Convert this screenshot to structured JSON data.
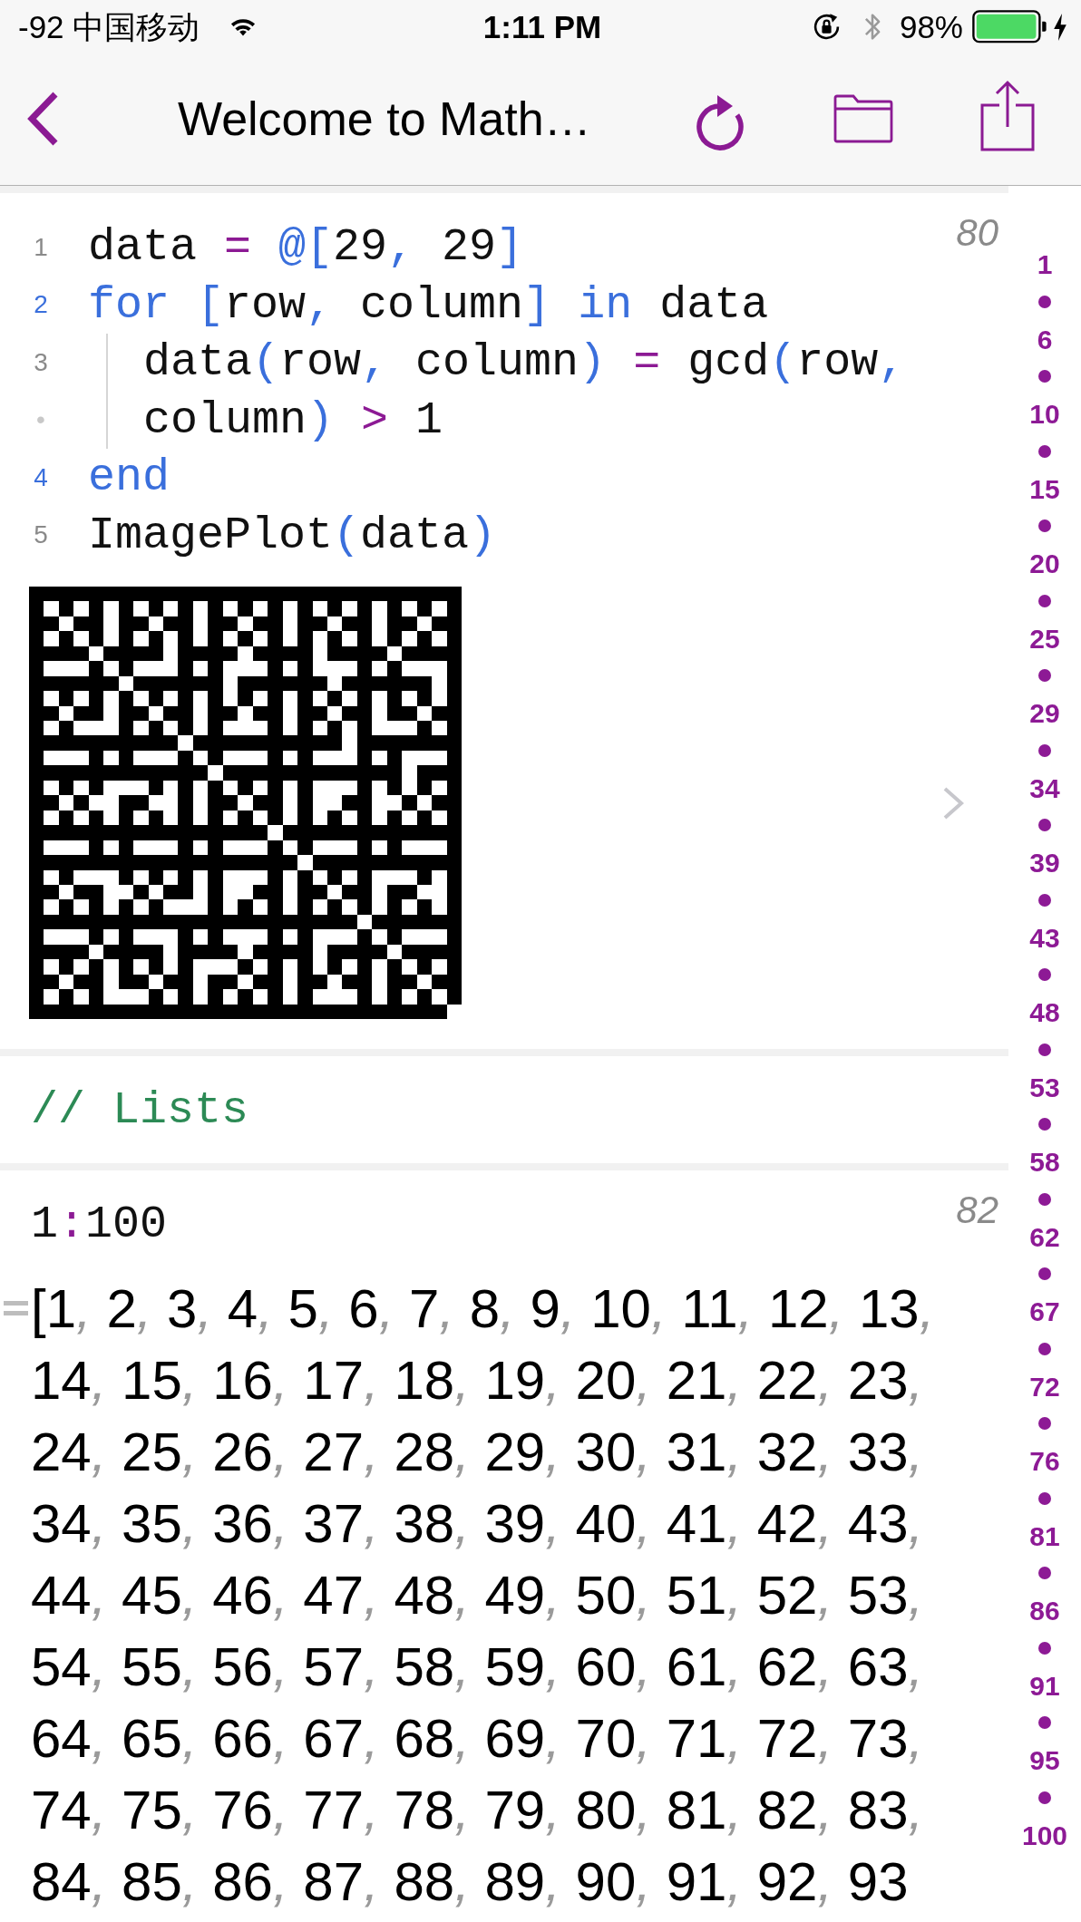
{
  "status_bar": {
    "carrier": "-92 中国移动",
    "time": "1:11 PM",
    "battery": "98%"
  },
  "nav_bar": {
    "title": "Welcome to Math…"
  },
  "cells": [
    {
      "counter": "80",
      "lines": [
        {
          "number": "1",
          "color": "#8a8a8a",
          "tokens": [
            {
              "text": "data ",
              "kind": "ident"
            },
            {
              "text": "=",
              "kind": "operator"
            },
            {
              "text": " @[",
              "kind": "punct"
            },
            {
              "text": "29",
              "kind": "number"
            },
            {
              "text": ", ",
              "kind": "punct"
            },
            {
              "text": "29",
              "kind": "number"
            },
            {
              "text": "]",
              "kind": "punct"
            }
          ]
        },
        {
          "number": "2",
          "color": "#3a6fdc",
          "tokens": [
            {
              "text": "for ",
              "kind": "keyword"
            },
            {
              "text": "[",
              "kind": "punct"
            },
            {
              "text": "row",
              "kind": "ident"
            },
            {
              "text": ", ",
              "kind": "punct"
            },
            {
              "text": "column",
              "kind": "ident"
            },
            {
              "text": "] ",
              "kind": "punct"
            },
            {
              "text": "in ",
              "kind": "keyword"
            },
            {
              "text": "data",
              "kind": "ident"
            }
          ],
          "children": [
            {
              "number": "3",
              "color": "#8a8a8a",
              "tokens": [
                {
                  "text": "data",
                  "kind": "ident"
                },
                {
                  "text": "(",
                  "kind": "punct"
                },
                {
                  "text": "row",
                  "kind": "ident"
                },
                {
                  "text": ", ",
                  "kind": "punct"
                },
                {
                  "text": "column",
                  "kind": "ident"
                },
                {
                  "text": ") ",
                  "kind": "punct"
                },
                {
                  "text": "=",
                  "kind": "operator"
                },
                {
                  "text": " gcd",
                  "kind": "ident"
                },
                {
                  "text": "(",
                  "kind": "punct"
                },
                {
                  "text": "row",
                  "kind": "ident"
                },
                {
                  "text": ",",
                  "kind": "punct"
                }
              ]
            },
            {
              "number": "•",
              "color": "#c8c8c8",
              "tokens": [
                {
                  "text": "column",
                  "kind": "ident"
                },
                {
                  "text": ") ",
                  "kind": "punct"
                },
                {
                  "text": ">",
                  "kind": "operator"
                },
                {
                  "text": " 1",
                  "kind": "number"
                }
              ]
            }
          ]
        },
        {
          "number": "4",
          "color": "#3a6fdc",
          "tokens": [
            {
              "text": "end",
              "kind": "keyword"
            }
          ]
        },
        {
          "number": "5",
          "color": "#8a8a8a",
          "tokens": [
            {
              "text": "ImagePlot",
              "kind": "ident"
            },
            {
              "text": "(",
              "kind": "punct"
            },
            {
              "text": "data",
              "kind": "ident"
            },
            {
              "text": ")",
              "kind": "punct"
            }
          ]
        }
      ],
      "output": {
        "kind": "image_plot"
      }
    },
    {
      "lines": [
        {
          "tokens": [
            {
              "text": "// Lists",
              "kind": "comment"
            }
          ]
        }
      ]
    },
    {
      "counter": "82",
      "lines": [
        {
          "tokens": [
            {
              "text": "1",
              "kind": "number"
            },
            {
              "text": ":",
              "kind": "operator"
            },
            {
              "text": "100",
              "kind": "number"
            }
          ]
        }
      ],
      "output": {
        "kind": "list",
        "open": "[",
        "separator": ",",
        "items": [
          "1",
          "2",
          "3",
          "4",
          "5",
          "6",
          "7",
          "8",
          "9",
          "10",
          "11",
          "12",
          "13",
          "14",
          "15",
          "16",
          "17",
          "18",
          "19",
          "20",
          "21",
          "22",
          "23",
          "24",
          "25",
          "26",
          "27",
          "28",
          "29",
          "30",
          "31",
          "32",
          "33",
          "34",
          "35",
          "36",
          "37",
          "38",
          "39",
          "40",
          "41",
          "42",
          "43",
          "44",
          "45",
          "46",
          "47",
          "48",
          "49",
          "50",
          "51",
          "52",
          "53",
          "54",
          "55",
          "56",
          "57",
          "58",
          "59",
          "60",
          "61",
          "62",
          "63",
          "64",
          "65",
          "66",
          "67",
          "68",
          "69",
          "70",
          "71",
          "72",
          "73",
          "74",
          "75",
          "76",
          "77",
          "78",
          "79",
          "80",
          "81",
          "82",
          "83",
          "84",
          "85",
          "86",
          "87",
          "88",
          "89",
          "90",
          "91",
          "92",
          "93"
        ]
      }
    }
  ],
  "index": [
    "1",
    "6",
    "10",
    "15",
    "20",
    "25",
    "29",
    "34",
    "39",
    "43",
    "48",
    "53",
    "58",
    "62",
    "67",
    "72",
    "76",
    "81",
    "86",
    "91",
    "95",
    "100"
  ]
}
